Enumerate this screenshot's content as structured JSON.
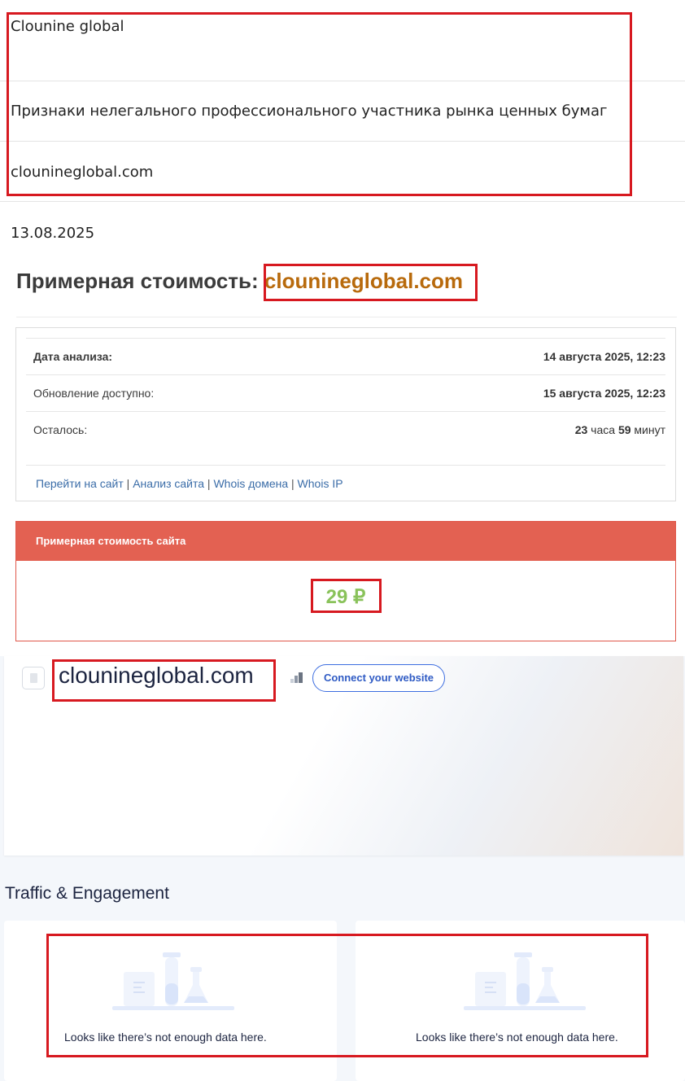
{
  "registry": {
    "company_name": "Clounine global",
    "reason": "Признаки нелегального профессионального участника рынка ценных бумаг",
    "domain": "clounineglobal.com",
    "date": "13.08.2025"
  },
  "valuation": {
    "title_prefix": "Примерная стоимость: ",
    "title_domain": "clounineglobal.com",
    "rows": [
      {
        "label": "Дата анализа:",
        "value": "14 августа 2025, 12:23"
      },
      {
        "label": "Обновление доступно:",
        "value": "15 августа 2025, 12:23"
      },
      {
        "label": "Осталось:",
        "value_hours": "23",
        "value_hours_word": " часа ",
        "value_minutes": "59",
        "value_minutes_word": " минут"
      }
    ],
    "links": [
      "Перейти на сайт",
      "Анализ сайта",
      "Whois домена",
      "Whois IP"
    ],
    "link_separator": " | ",
    "estimate_header": "Примерная стоимость сайта",
    "estimate_value": "29 ₽",
    "colors": {
      "accent_header": "#e36152",
      "estimate_value": "#89c25a",
      "domain_highlight": "#b86a0c"
    }
  },
  "similarweb": {
    "domain": "clounineglobal.com",
    "connect_button": "Connect your website",
    "section_title": "Traffic & Engagement",
    "no_data_text_1": "Looks like there’s not enough data here.",
    "no_data_text_2": "Looks like there’s not enough data here.",
    "icons": {
      "favicon": "document-icon",
      "rank": "rank-bars-icon",
      "illustration": "lab-flasks-icon"
    },
    "colors": {
      "button_border": "#3d6ee0",
      "text": "#1c2440"
    }
  },
  "annotation_color": "#d71920"
}
